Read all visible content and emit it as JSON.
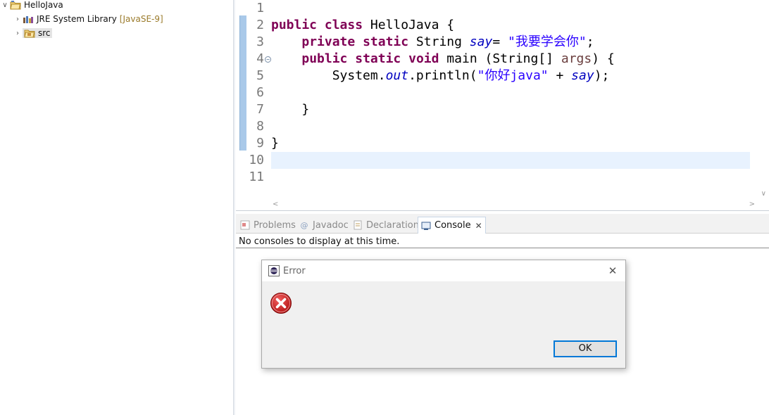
{
  "explorer": {
    "project": {
      "label": "HelloJava"
    },
    "items": [
      {
        "label": "JRE System Library",
        "decoration": "[JavaSE-9]"
      },
      {
        "label": "src"
      }
    ]
  },
  "editor": {
    "line_numbers": [
      "1",
      "2",
      "3",
      "4",
      "5",
      "6",
      "7",
      "8",
      "9",
      "10",
      "11"
    ],
    "lines": [
      [],
      [
        {
          "t": "public",
          "c": "kw"
        },
        {
          "t": " "
        },
        {
          "t": "class",
          "c": "kw"
        },
        {
          "t": " HelloJava {"
        }
      ],
      [
        {
          "t": "    "
        },
        {
          "t": "private",
          "c": "kw"
        },
        {
          "t": " "
        },
        {
          "t": "static",
          "c": "kw"
        },
        {
          "t": " String "
        },
        {
          "t": "say",
          "c": "fld"
        },
        {
          "t": "= "
        },
        {
          "t": "\"我要学会你\"",
          "c": "str"
        },
        {
          "t": ";"
        }
      ],
      [
        {
          "t": "    "
        },
        {
          "t": "public",
          "c": "kw"
        },
        {
          "t": " "
        },
        {
          "t": "static",
          "c": "kw"
        },
        {
          "t": " "
        },
        {
          "t": "void",
          "c": "kw"
        },
        {
          "t": " main (String[] "
        },
        {
          "t": "args",
          "c": "var"
        },
        {
          "t": ") {"
        }
      ],
      [
        {
          "t": "        System."
        },
        {
          "t": "out",
          "c": "fld"
        },
        {
          "t": ".println("
        },
        {
          "t": "\"你好java\"",
          "c": "str"
        },
        {
          "t": " + "
        },
        {
          "t": "say",
          "c": "fld"
        },
        {
          "t": ");"
        }
      ],
      [],
      [
        {
          "t": "    }"
        }
      ],
      [],
      [
        {
          "t": "}"
        }
      ],
      [],
      []
    ],
    "current_line_index": 9,
    "fold_line_index": 3
  },
  "views": {
    "tabs": [
      {
        "label": "Problems",
        "icon": "problems-icon",
        "active": false
      },
      {
        "label": "Javadoc",
        "icon": "javadoc-icon",
        "active": false
      },
      {
        "label": "Declaration",
        "icon": "declaration-icon",
        "active": false
      },
      {
        "label": "Console",
        "icon": "console-icon",
        "active": true
      }
    ],
    "console_message": "No consoles to display at this time."
  },
  "dialog": {
    "title": "Error",
    "ok_label": "OK"
  },
  "colors": {
    "keyword": "#7f0055",
    "field": "#0000c0",
    "string": "#2a00ff",
    "local_var": "#6a3e3e",
    "current_line": "#e8f2fe",
    "focus_border": "#0078d7"
  }
}
